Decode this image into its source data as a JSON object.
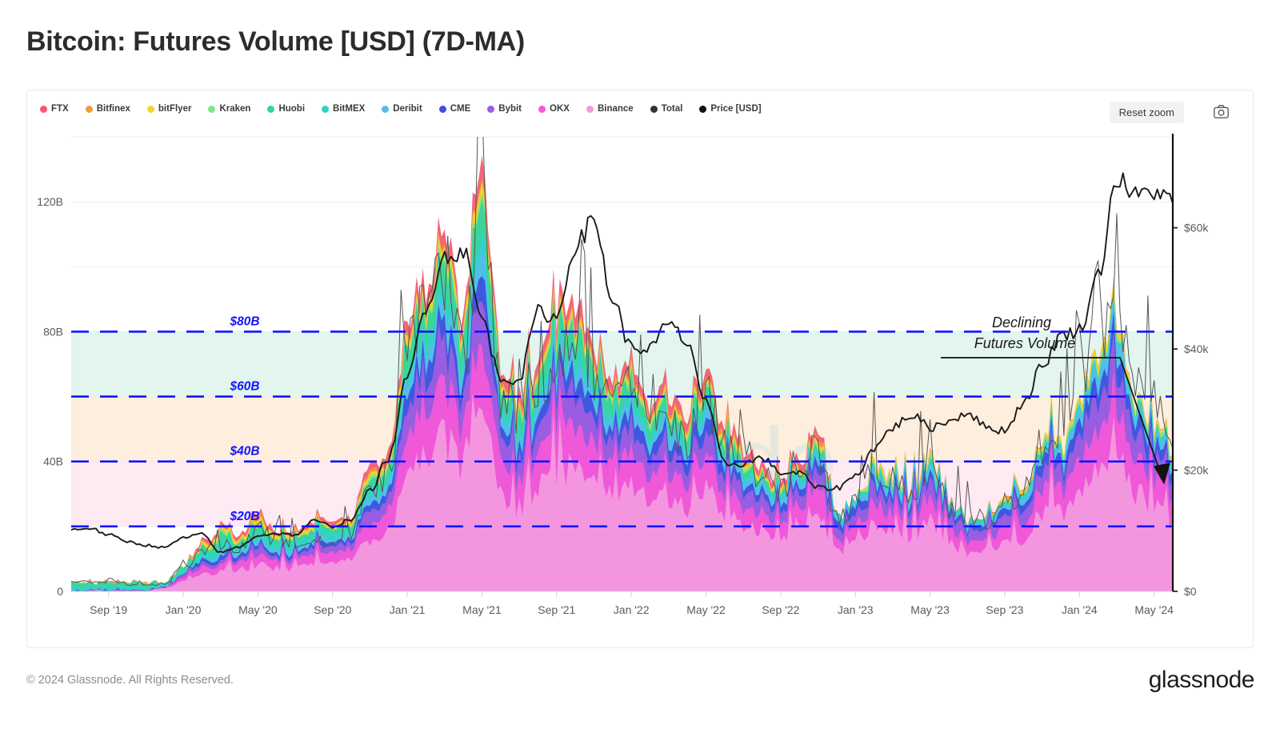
{
  "page": {
    "title": "Bitcoin: Futures Volume [USD] (7D-MA)",
    "footer_copyright": "© 2024 Glassnode. All Rights Reserved.",
    "footer_logo": "glassnode",
    "watermark": "glassnode"
  },
  "toolbar": {
    "reset_zoom_label": "Reset zoom",
    "camera_icon": "camera-icon"
  },
  "legend": {
    "items": [
      {
        "label": "FTX",
        "color": "#f2596f"
      },
      {
        "label": "Bitfinex",
        "color": "#ef9a3e"
      },
      {
        "label": "bitFlyer",
        "color": "#f6d32d"
      },
      {
        "label": "Kraken",
        "color": "#7ee787"
      },
      {
        "label": "Huobi",
        "color": "#36d39a"
      },
      {
        "label": "BitMEX",
        "color": "#2fd4c4"
      },
      {
        "label": "Deribit",
        "color": "#54bdea"
      },
      {
        "label": "CME",
        "color": "#3f4fe0"
      },
      {
        "label": "Bybit",
        "color": "#a05de0"
      },
      {
        "label": "OKX",
        "color": "#f658d8"
      },
      {
        "label": "Binance",
        "color": "#f49be0"
      },
      {
        "label": "Total",
        "color": "#333333"
      },
      {
        "label": "Price [USD]",
        "color": "#111111"
      }
    ]
  },
  "annotation": {
    "line1": "Declining",
    "line2": "Futures Volume"
  },
  "bands": [
    {
      "label": "$20B",
      "value": 20,
      "fill": "#fdeaf3"
    },
    {
      "label": "$40B",
      "value": 40,
      "fill": "#fdeedd"
    },
    {
      "label": "$60B",
      "value": 60,
      "fill": "#e2f5ee"
    },
    {
      "label": "$80B",
      "value": 80,
      "fill": "#ffffff"
    }
  ],
  "chart_data": {
    "type": "area",
    "title": "Bitcoin: Futures Volume [USD] (7D-MA)",
    "subtitle": "",
    "xlabel": "",
    "ylabel": "Futures Volume [USD]",
    "y2label": "Price [USD]",
    "grid": true,
    "legend_position": "top-left",
    "stacked": true,
    "ylim": [
      0,
      140
    ],
    "yticks": [
      0,
      40,
      80,
      120
    ],
    "ytick_labels": [
      "0",
      "40B",
      "80B",
      "120B"
    ],
    "y2lim": [
      0,
      75000
    ],
    "y2ticks": [
      0,
      20000,
      40000,
      60000
    ],
    "y2tick_labels": [
      "$0",
      "$20k",
      "$40k",
      "$60k"
    ],
    "xticks": [
      "Sep '19",
      "Jan '20",
      "May '20",
      "Sep '20",
      "Jan '21",
      "May '21",
      "Sep '21",
      "Jan '22",
      "May '22",
      "Sep '22",
      "Jan '23",
      "May '23",
      "Sep '23",
      "Jan '24",
      "May '24"
    ],
    "x_range": [
      "2019-07",
      "2024-07"
    ],
    "threshold_lines": [
      {
        "value": 20,
        "label": "$20B",
        "color": "#1414ff",
        "style": "dashed"
      },
      {
        "value": 40,
        "label": "$40B",
        "color": "#1414ff",
        "style": "dashed"
      },
      {
        "value": 60,
        "label": "$60B",
        "color": "#1414ff",
        "style": "dashed"
      },
      {
        "value": 80,
        "label": "$80B",
        "color": "#1414ff",
        "style": "dashed"
      }
    ],
    "annotations": [
      {
        "text": "Declining Futures Volume",
        "kind": "arrow",
        "points_to": "2024-06"
      }
    ],
    "x_months": [
      "2019-07",
      "2019-08",
      "2019-09",
      "2019-10",
      "2019-11",
      "2019-12",
      "2020-01",
      "2020-02",
      "2020-03",
      "2020-04",
      "2020-05",
      "2020-06",
      "2020-07",
      "2020-08",
      "2020-09",
      "2020-10",
      "2020-11",
      "2020-12",
      "2021-01",
      "2021-02",
      "2021-03",
      "2021-04",
      "2021-05",
      "2021-06",
      "2021-07",
      "2021-08",
      "2021-09",
      "2021-10",
      "2021-11",
      "2021-12",
      "2022-01",
      "2022-02",
      "2022-03",
      "2022-04",
      "2022-05",
      "2022-06",
      "2022-07",
      "2022-08",
      "2022-09",
      "2022-10",
      "2022-11",
      "2022-12",
      "2023-01",
      "2023-02",
      "2023-03",
      "2023-04",
      "2023-05",
      "2023-06",
      "2023-07",
      "2023-08",
      "2023-09",
      "2023-10",
      "2023-11",
      "2023-12",
      "2024-01",
      "2024-02",
      "2024-03",
      "2024-04",
      "2024-05",
      "2024-06"
    ],
    "series": [
      {
        "name": "Total",
        "color": "#333333",
        "type": "line",
        "values": [
          3,
          3,
          3,
          2,
          2,
          2,
          7,
          12,
          14,
          13,
          18,
          15,
          14,
          15,
          14,
          18,
          30,
          36,
          72,
          84,
          96,
          74,
          120,
          60,
          52,
          62,
          70,
          78,
          66,
          54,
          62,
          48,
          52,
          46,
          58,
          44,
          40,
          36,
          30,
          34,
          44,
          22,
          26,
          38,
          34,
          30,
          40,
          26,
          22,
          22,
          26,
          30,
          44,
          46,
          62,
          78,
          84,
          62,
          56,
          44
        ]
      },
      {
        "name": "Binance",
        "color": "#f49be0",
        "type": "area",
        "values": [
          0,
          0,
          0,
          0,
          0,
          1,
          3,
          5,
          6,
          6,
          8,
          7,
          7,
          8,
          8,
          10,
          16,
          19,
          34,
          40,
          46,
          36,
          56,
          29,
          26,
          31,
          35,
          39,
          34,
          28,
          32,
          25,
          27,
          24,
          30,
          23,
          21,
          19,
          16,
          18,
          23,
          12,
          14,
          20,
          18,
          16,
          21,
          14,
          12,
          12,
          14,
          16,
          23,
          24,
          31,
          38,
          40,
          30,
          27,
          22
        ]
      },
      {
        "name": "OKX",
        "color": "#f658d8",
        "type": "area",
        "values": [
          0,
          0,
          0,
          0,
          0,
          0,
          1,
          2,
          2,
          2,
          3,
          2,
          2,
          3,
          3,
          3,
          5,
          6,
          11,
          13,
          15,
          11,
          18,
          9,
          8,
          10,
          11,
          12,
          10,
          8,
          10,
          7,
          8,
          7,
          9,
          7,
          6,
          5,
          5,
          5,
          7,
          3,
          4,
          6,
          5,
          4,
          6,
          4,
          3,
          3,
          4,
          5,
          7,
          7,
          10,
          12,
          13,
          9,
          8,
          7
        ]
      },
      {
        "name": "Bybit",
        "color": "#a05de0",
        "type": "area",
        "values": [
          0,
          0,
          0,
          0,
          0,
          0,
          1,
          1,
          1,
          1,
          2,
          1,
          1,
          2,
          2,
          2,
          4,
          4,
          8,
          9,
          11,
          8,
          13,
          7,
          6,
          7,
          8,
          9,
          7,
          6,
          7,
          5,
          6,
          5,
          7,
          5,
          5,
          4,
          3,
          4,
          5,
          3,
          3,
          4,
          4,
          3,
          5,
          3,
          3,
          3,
          3,
          4,
          5,
          5,
          7,
          9,
          10,
          7,
          6,
          5
        ]
      },
      {
        "name": "CME",
        "color": "#3f4fe0",
        "type": "area",
        "values": [
          0,
          0,
          0,
          0,
          0,
          0,
          0,
          1,
          1,
          1,
          1,
          1,
          1,
          1,
          1,
          1,
          2,
          2,
          4,
          5,
          6,
          4,
          7,
          3,
          3,
          4,
          4,
          5,
          4,
          3,
          4,
          3,
          3,
          3,
          4,
          3,
          2,
          2,
          2,
          2,
          3,
          2,
          2,
          2,
          2,
          2,
          2,
          2,
          1,
          1,
          2,
          2,
          3,
          3,
          4,
          5,
          6,
          4,
          4,
          3
        ]
      },
      {
        "name": "Deribit",
        "color": "#54bdea",
        "type": "area",
        "values": [
          0,
          0,
          0,
          0,
          0,
          0,
          0,
          0,
          1,
          1,
          1,
          1,
          1,
          1,
          1,
          1,
          2,
          2,
          4,
          4,
          5,
          4,
          6,
          3,
          3,
          3,
          4,
          4,
          3,
          3,
          3,
          2,
          3,
          2,
          3,
          2,
          2,
          2,
          2,
          2,
          2,
          1,
          1,
          2,
          2,
          2,
          2,
          1,
          1,
          1,
          1,
          2,
          2,
          2,
          3,
          4,
          5,
          3,
          3,
          2
        ]
      },
      {
        "name": "BitMEX",
        "color": "#2fd4c4",
        "type": "area",
        "values": [
          1,
          1,
          1,
          1,
          1,
          1,
          1,
          2,
          2,
          2,
          2,
          2,
          2,
          2,
          2,
          2,
          2,
          2,
          3,
          3,
          4,
          3,
          5,
          2,
          2,
          2,
          3,
          3,
          2,
          2,
          2,
          2,
          2,
          2,
          2,
          2,
          1,
          1,
          1,
          1,
          1,
          1,
          1,
          1,
          1,
          1,
          1,
          1,
          1,
          1,
          1,
          1,
          1,
          1,
          1,
          1,
          1,
          1,
          1,
          1
        ]
      },
      {
        "name": "Huobi",
        "color": "#36d39a",
        "type": "area",
        "values": [
          1,
          1,
          1,
          1,
          1,
          0,
          1,
          1,
          2,
          1,
          2,
          1,
          1,
          1,
          1,
          1,
          2,
          2,
          6,
          7,
          8,
          6,
          10,
          5,
          4,
          5,
          5,
          6,
          5,
          4,
          4,
          3,
          3,
          3,
          3,
          2,
          2,
          1,
          1,
          1,
          1,
          0,
          0,
          0,
          0,
          0,
          0,
          0,
          0,
          0,
          0,
          0,
          0,
          0,
          0,
          0,
          0,
          0,
          0,
          0
        ]
      },
      {
        "name": "Kraken",
        "color": "#7ee787",
        "type": "area",
        "values": [
          0,
          0,
          0,
          0,
          0,
          0,
          0,
          0,
          1,
          0,
          1,
          0,
          0,
          0,
          0,
          0,
          1,
          1,
          1,
          1,
          2,
          1,
          2,
          1,
          1,
          1,
          1,
          1,
          1,
          1,
          1,
          1,
          1,
          1,
          1,
          1,
          1,
          0,
          0,
          0,
          1,
          0,
          0,
          1,
          1,
          0,
          1,
          0,
          0,
          0,
          0,
          0,
          1,
          1,
          1,
          1,
          1,
          1,
          1,
          1
        ]
      },
      {
        "name": "bitFlyer",
        "color": "#f6d32d",
        "type": "area",
        "values": [
          0,
          0,
          0,
          0,
          0,
          0,
          0,
          1,
          1,
          1,
          1,
          1,
          1,
          1,
          1,
          1,
          1,
          1,
          2,
          2,
          2,
          2,
          3,
          1,
          1,
          1,
          2,
          2,
          1,
          1,
          1,
          1,
          1,
          1,
          1,
          1,
          1,
          1,
          1,
          1,
          1,
          0,
          0,
          1,
          1,
          1,
          1,
          0,
          0,
          0,
          1,
          1,
          1,
          1,
          1,
          2,
          2,
          1,
          1,
          1
        ]
      },
      {
        "name": "Bitfinex",
        "color": "#ef9a3e",
        "type": "area",
        "values": [
          0,
          0,
          0,
          0,
          0,
          0,
          0,
          0,
          0,
          0,
          1,
          0,
          0,
          0,
          0,
          0,
          1,
          1,
          1,
          1,
          1,
          1,
          1,
          1,
          1,
          1,
          1,
          1,
          1,
          1,
          1,
          1,
          1,
          1,
          1,
          1,
          1,
          0,
          0,
          0,
          1,
          0,
          0,
          0,
          0,
          0,
          0,
          0,
          0,
          0,
          0,
          0,
          0,
          0,
          0,
          0,
          0,
          0,
          0,
          0
        ]
      },
      {
        "name": "FTX",
        "color": "#f2596f",
        "type": "area",
        "values": [
          0,
          0,
          0,
          0,
          0,
          0,
          0,
          1,
          1,
          1,
          1,
          1,
          1,
          1,
          1,
          1,
          2,
          2,
          3,
          4,
          4,
          3,
          5,
          3,
          3,
          3,
          4,
          4,
          3,
          3,
          3,
          2,
          3,
          2,
          3,
          2,
          2,
          2,
          2,
          2,
          2,
          0,
          0,
          0,
          0,
          0,
          0,
          0,
          0,
          0,
          0,
          0,
          0,
          0,
          0,
          0,
          0,
          0,
          0,
          0
        ]
      },
      {
        "name": "Price [USD]",
        "color": "#111111",
        "type": "line_right",
        "values": [
          10200,
          10400,
          9300,
          8200,
          7600,
          7200,
          8800,
          9400,
          6400,
          7300,
          9200,
          9500,
          9300,
          11600,
          10700,
          11900,
          16500,
          22000,
          35000,
          47000,
          55000,
          56000,
          45000,
          35000,
          35000,
          46000,
          45000,
          57000,
          61000,
          48000,
          40000,
          40000,
          44000,
          41000,
          31000,
          21000,
          21000,
          22000,
          19500,
          19500,
          17000,
          17000,
          19000,
          23500,
          27000,
          29000,
          27000,
          28000,
          29500,
          27000,
          26500,
          31000,
          37000,
          42000,
          43000,
          52000,
          68000,
          65000,
          66000,
          64000
        ]
      }
    ]
  }
}
